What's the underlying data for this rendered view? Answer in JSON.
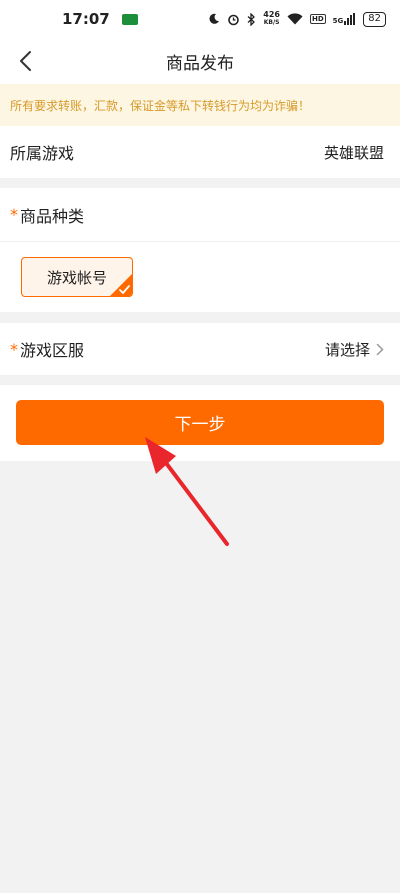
{
  "status_bar": {
    "time": "17:07",
    "net_speed_value": "426",
    "net_speed_unit": "KB/S",
    "hd_label": "HD",
    "signal_label": "5G",
    "battery": "82"
  },
  "nav": {
    "title": "商品发布",
    "back_icon": "chevron-left-icon"
  },
  "notice": {
    "text": "所有要求转账，汇款，保证金等私下转钱行为均为诈骗！",
    "color": "#d79a2a"
  },
  "game_row": {
    "label": "所属游戏",
    "value": "英雄联盟"
  },
  "category": {
    "required_mark": "*",
    "label": "商品种类",
    "options": [
      {
        "label": "游戏帐号",
        "selected": true
      }
    ]
  },
  "server_row": {
    "required_mark": "*",
    "label": "游戏区服",
    "value": "请选择"
  },
  "next_button": {
    "label": "下一步"
  },
  "colors": {
    "accent": "#ff6a00",
    "background": "#f2f2f2",
    "annotation": "#e8262b"
  }
}
